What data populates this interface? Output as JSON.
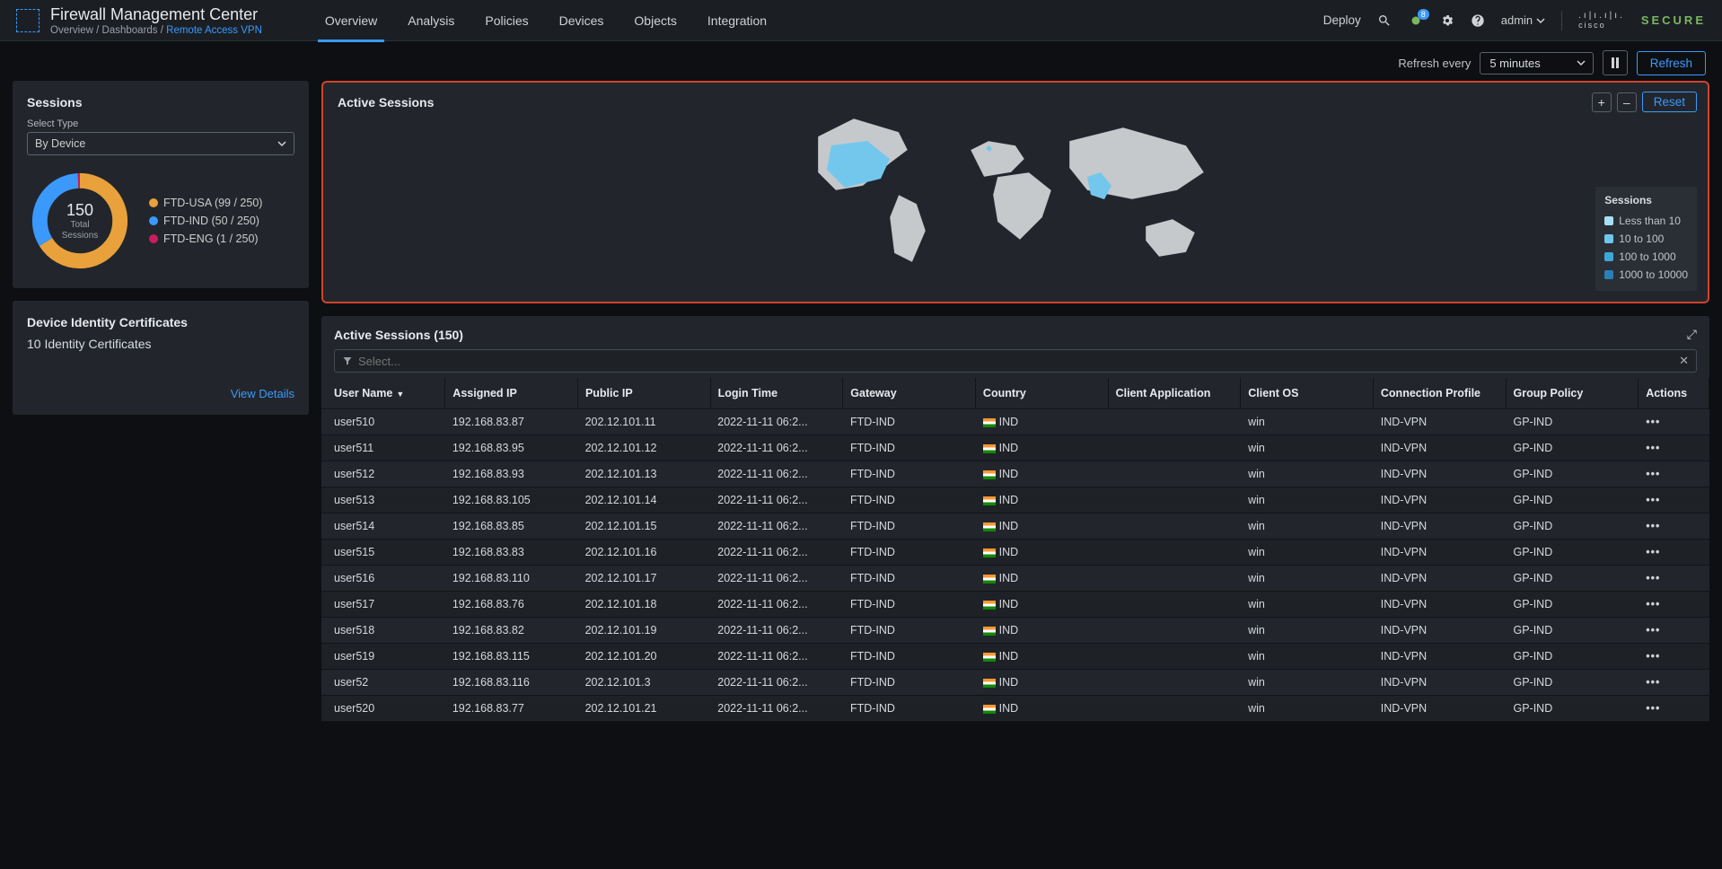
{
  "app": {
    "title": "Firewall Management Center",
    "crumbs": [
      "Overview",
      "Dashboards",
      "Remote Access VPN"
    ]
  },
  "nav": {
    "items": [
      "Overview",
      "Analysis",
      "Policies",
      "Devices",
      "Objects",
      "Integration"
    ],
    "active": 0
  },
  "header": {
    "deploy": "Deploy",
    "alert_count": "8",
    "user": "admin",
    "brand1": "cisco",
    "brand2": "SECURE"
  },
  "refresh": {
    "label": "Refresh every",
    "interval": "5 minutes",
    "button": "Refresh"
  },
  "sessions_panel": {
    "title": "Sessions",
    "select_label": "Select Type",
    "select_value": "By Device",
    "total": "150",
    "total_label1": "Total",
    "total_label2": "Sessions",
    "legend": [
      {
        "color": "#e9a13b",
        "label": "FTD-USA (99 / 250)"
      },
      {
        "color": "#3b99fc",
        "label": "FTD-IND (50 / 250)"
      },
      {
        "color": "#c81d5e",
        "label": "FTD-ENG (1 / 250)"
      }
    ]
  },
  "devcert": {
    "title": "Device Identity Certificates",
    "text": "10 Identity Certificates",
    "link": "View Details"
  },
  "map_panel": {
    "title": "Active Sessions",
    "zoom_in": "+",
    "zoom_out": "–",
    "reset": "Reset",
    "legend_title": "Sessions",
    "legend": [
      {
        "color": "#a9dff5",
        "label": "Less than 10"
      },
      {
        "color": "#6fc7ec",
        "label": "10 to 100"
      },
      {
        "color": "#3ea7da",
        "label": "100 to 1000"
      },
      {
        "color": "#2b7fb8",
        "label": "1000 to 10000"
      }
    ]
  },
  "table": {
    "title": "Active Sessions (150)",
    "search_placeholder": "Select...",
    "columns": [
      "User Name",
      "Assigned IP",
      "Public IP",
      "Login Time",
      "Gateway",
      "Country",
      "Client Application",
      "Client OS",
      "Connection Profile",
      "Group Policy",
      "Actions"
    ],
    "rows": [
      {
        "user": "user510",
        "assip": "192.168.83.87",
        "pubip": "202.12.101.11",
        "login": "2022-11-11 06:2...",
        "gw": "FTD-IND",
        "cty": "IND",
        "app": "",
        "os": "win",
        "conn": "IND-VPN",
        "gp": "GP-IND"
      },
      {
        "user": "user511",
        "assip": "192.168.83.95",
        "pubip": "202.12.101.12",
        "login": "2022-11-11 06:2...",
        "gw": "FTD-IND",
        "cty": "IND",
        "app": "",
        "os": "win",
        "conn": "IND-VPN",
        "gp": "GP-IND"
      },
      {
        "user": "user512",
        "assip": "192.168.83.93",
        "pubip": "202.12.101.13",
        "login": "2022-11-11 06:2...",
        "gw": "FTD-IND",
        "cty": "IND",
        "app": "",
        "os": "win",
        "conn": "IND-VPN",
        "gp": "GP-IND"
      },
      {
        "user": "user513",
        "assip": "192.168.83.105",
        "pubip": "202.12.101.14",
        "login": "2022-11-11 06:2...",
        "gw": "FTD-IND",
        "cty": "IND",
        "app": "",
        "os": "win",
        "conn": "IND-VPN",
        "gp": "GP-IND"
      },
      {
        "user": "user514",
        "assip": "192.168.83.85",
        "pubip": "202.12.101.15",
        "login": "2022-11-11 06:2...",
        "gw": "FTD-IND",
        "cty": "IND",
        "app": "",
        "os": "win",
        "conn": "IND-VPN",
        "gp": "GP-IND"
      },
      {
        "user": "user515",
        "assip": "192.168.83.83",
        "pubip": "202.12.101.16",
        "login": "2022-11-11 06:2...",
        "gw": "FTD-IND",
        "cty": "IND",
        "app": "",
        "os": "win",
        "conn": "IND-VPN",
        "gp": "GP-IND"
      },
      {
        "user": "user516",
        "assip": "192.168.83.110",
        "pubip": "202.12.101.17",
        "login": "2022-11-11 06:2...",
        "gw": "FTD-IND",
        "cty": "IND",
        "app": "",
        "os": "win",
        "conn": "IND-VPN",
        "gp": "GP-IND"
      },
      {
        "user": "user517",
        "assip": "192.168.83.76",
        "pubip": "202.12.101.18",
        "login": "2022-11-11 06:2...",
        "gw": "FTD-IND",
        "cty": "IND",
        "app": "",
        "os": "win",
        "conn": "IND-VPN",
        "gp": "GP-IND"
      },
      {
        "user": "user518",
        "assip": "192.168.83.82",
        "pubip": "202.12.101.19",
        "login": "2022-11-11 06:2...",
        "gw": "FTD-IND",
        "cty": "IND",
        "app": "",
        "os": "win",
        "conn": "IND-VPN",
        "gp": "GP-IND"
      },
      {
        "user": "user519",
        "assip": "192.168.83.115",
        "pubip": "202.12.101.20",
        "login": "2022-11-11 06:2...",
        "gw": "FTD-IND",
        "cty": "IND",
        "app": "",
        "os": "win",
        "conn": "IND-VPN",
        "gp": "GP-IND"
      },
      {
        "user": "user52",
        "assip": "192.168.83.116",
        "pubip": "202.12.101.3",
        "login": "2022-11-11 06:2...",
        "gw": "FTD-IND",
        "cty": "IND",
        "app": "",
        "os": "win",
        "conn": "IND-VPN",
        "gp": "GP-IND"
      },
      {
        "user": "user520",
        "assip": "192.168.83.77",
        "pubip": "202.12.101.21",
        "login": "2022-11-11 06:2...",
        "gw": "FTD-IND",
        "cty": "IND",
        "app": "",
        "os": "win",
        "conn": "IND-VPN",
        "gp": "GP-IND"
      }
    ]
  },
  "chart_data": {
    "type": "pie",
    "title": "Sessions by Device",
    "series": [
      {
        "name": "FTD-USA",
        "value": 99,
        "capacity": 250
      },
      {
        "name": "FTD-IND",
        "value": 50,
        "capacity": 250
      },
      {
        "name": "FTD-ENG",
        "value": 1,
        "capacity": 250
      }
    ],
    "total": 150
  }
}
